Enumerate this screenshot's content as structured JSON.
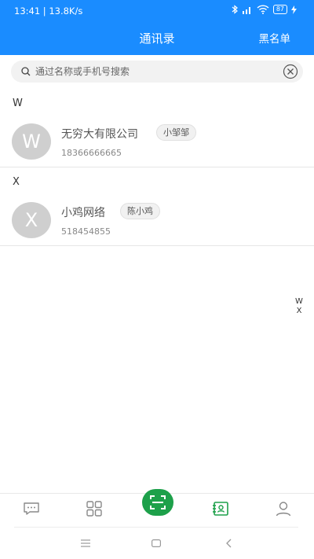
{
  "status_bar": {
    "time_speed": "13:41 | 13.8K/s",
    "battery": "87"
  },
  "header": {
    "title": "通讯录",
    "blacklist_label": "黑名单"
  },
  "search": {
    "placeholder": "通过名称或手机号搜索"
  },
  "sections": [
    {
      "letter": "W",
      "contacts": [
        {
          "avatar_letter": "W",
          "name": "无穷大有限公司",
          "tag": "小邹邹",
          "phone": "18366666665"
        }
      ]
    },
    {
      "letter": "X",
      "contacts": [
        {
          "avatar_letter": "X",
          "name": "小鸡网络",
          "tag": "陈小鸡",
          "phone": "518454855"
        }
      ]
    }
  ],
  "index_bar": [
    "W",
    "X"
  ],
  "tabs": [
    {
      "icon": "chat-icon"
    },
    {
      "icon": "grid-icon"
    },
    {
      "icon": "scan-icon"
    },
    {
      "icon": "contacts-book-icon",
      "active": true
    },
    {
      "icon": "profile-icon"
    }
  ],
  "colors": {
    "header_bg": "#1a8cff",
    "scan_button": "#1da04a",
    "active_tab": "#1da04a",
    "inactive_tab": "#888888"
  }
}
